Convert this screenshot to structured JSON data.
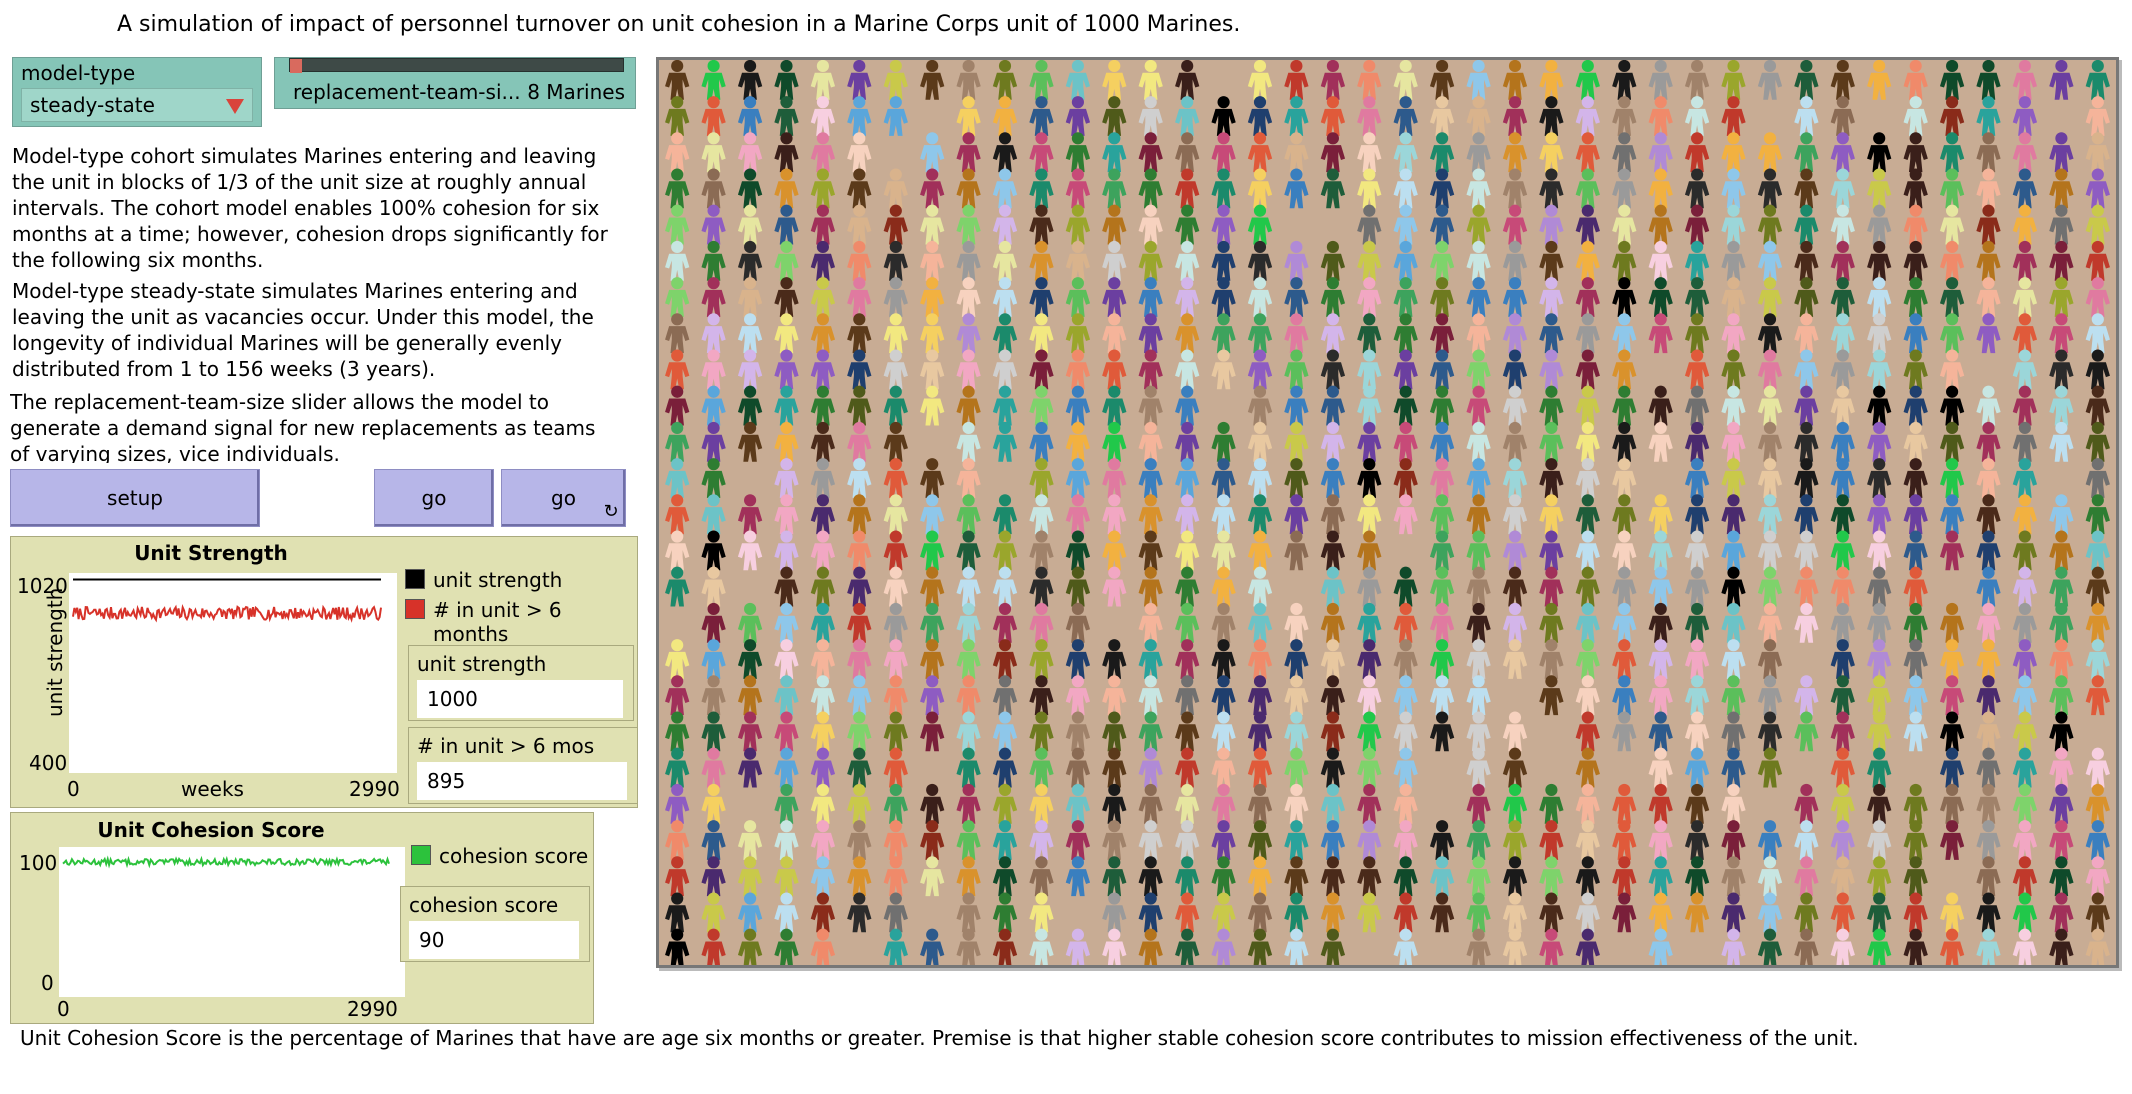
{
  "header": {
    "title": "A simulation of impact of personnel turnover on unit cohesion in a Marine Corps unit of 1000 Marines."
  },
  "chooser": {
    "label": "model-type",
    "value": "steady-state"
  },
  "slider": {
    "label": "replacement-team-si...",
    "value": "8 Marines",
    "fraction": 0.0
  },
  "notes": [
    "Model-type cohort simulates Marines entering and leaving the unit in blocks of 1/3 of the unit size at roughly annual intervals.  The cohort model enables 100% cohesion for six months at a time; however, cohesion drops significantly for the following six months.",
    "Model-type steady-state simulates Marines entering and leaving the unit as vacancies occur.  Under this model, the longevity of individual Marines will be generally evenly distributed from 1 to 156 weeks (3 years).",
    "The replacement-team-size slider allows the model to generate a demand signal for new replacements as teams of varying sizes, vice individuals."
  ],
  "buttons": {
    "setup": "setup",
    "go_once": "go",
    "go_forever": "go",
    "forever_icon": "↻"
  },
  "plot1": {
    "title": "Unit Strength",
    "ylabel": "unit strength",
    "xlabel": "weeks",
    "ymax": "1020",
    "ymin": "400",
    "xmin": "0",
    "xmax": "2990",
    "legend": [
      {
        "label": "unit strength",
        "color": "#000000"
      },
      {
        "label": "# in unit > 6 months",
        "color": "#d73229"
      }
    ]
  },
  "monitor_strength": {
    "label": "unit strength",
    "value": "1000"
  },
  "monitor_6mos": {
    "label": "# in unit > 6 mos",
    "value": "895"
  },
  "plot2": {
    "title": "Unit Cohesion Score",
    "ymax": "100",
    "ymin": "0",
    "xmin": "0",
    "xmax": "2990",
    "legend": [
      {
        "label": "cohesion score",
        "color": "#2cc23c"
      }
    ]
  },
  "monitor_cohesion": {
    "label": "cohesion score",
    "value": "90"
  },
  "chart_data": [
    {
      "type": "line",
      "title": "Unit Strength",
      "xlabel": "weeks",
      "ylabel": "unit strength",
      "xlim": [
        0,
        2990
      ],
      "ylim": [
        400,
        1020
      ],
      "series": [
        {
          "name": "unit strength",
          "color": "#000000",
          "x": [
            0,
            2990
          ],
          "y": [
            1000,
            1000
          ]
        },
        {
          "name": "# in unit > 6 months",
          "color": "#d73229",
          "x": [
            0,
            2990
          ],
          "y": [
            895,
            895
          ],
          "noise_amplitude": 20
        }
      ]
    },
    {
      "type": "line",
      "title": "Unit Cohesion Score",
      "xlim": [
        0,
        2990
      ],
      "ylim": [
        0,
        100
      ],
      "series": [
        {
          "name": "cohesion score",
          "color": "#2cc23c",
          "x": [
            0,
            2990
          ],
          "y": [
            90,
            90
          ],
          "noise_amplitude": 2
        }
      ]
    }
  ],
  "world": {
    "background": "#c8ac94",
    "agent_icon": "person-icon",
    "agent_count": 1000,
    "palette": [
      "#000000",
      "#1a1a1a",
      "#2b2b2b",
      "#3a1f1a",
      "#4a2a1a",
      "#5b3a1a",
      "#0f4a2a",
      "#1e5d3a",
      "#2e7d32",
      "#3da35d",
      "#5bbf5b",
      "#7ed36b",
      "#21c84a",
      "#1b8a6b",
      "#29a39c",
      "#6cc3c7",
      "#9bd6d9",
      "#c7e6e2",
      "#cfcfcf",
      "#9a9a9a",
      "#707070",
      "#1f3f6e",
      "#2d5a8c",
      "#3a7fbf",
      "#5aa6db",
      "#8ec7ea",
      "#bcdff0",
      "#4a2a6e",
      "#6b3fa0",
      "#8e5cc2",
      "#b08ad6",
      "#d3b5ea",
      "#7a1f3a",
      "#a1305a",
      "#c74a78",
      "#e07aa0",
      "#f2a7c3",
      "#f7cfe0",
      "#8a2b1a",
      "#c0392b",
      "#e05a3a",
      "#f08a6a",
      "#f5b49a",
      "#f7d2bf",
      "#b4741c",
      "#d9922c",
      "#f2b140",
      "#f5d060",
      "#f2e880",
      "#c9c94a",
      "#9aa62c",
      "#6e7a1f",
      "#4f5a1a",
      "#d9b38c",
      "#e8c8a0",
      "#a0826a",
      "#8b6b54",
      "#e6e6a0"
    ]
  },
  "footer": {
    "text": "Unit Cohesion Score is the percentage of Marines that have are age six months or greater.  Premise is that higher stable cohesion score contributes to mission effectiveness of the unit."
  }
}
